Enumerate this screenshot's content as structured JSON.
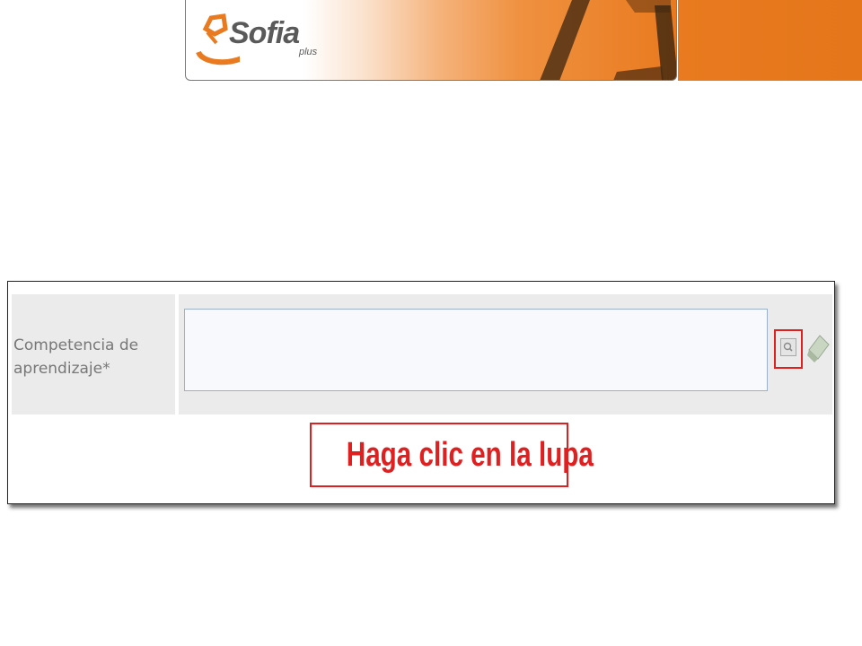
{
  "header": {
    "logo_name": "Sofia",
    "logo_sub": "plus",
    "accent_color": "#e97a1f"
  },
  "form": {
    "field_label": "Competencia de aprendizaje*",
    "field_value": "",
    "search_icon": "magnifier-icon",
    "clear_icon": "eraser-icon"
  },
  "callout": {
    "text": "Haga clic en la lupa",
    "color": "#e02020"
  }
}
